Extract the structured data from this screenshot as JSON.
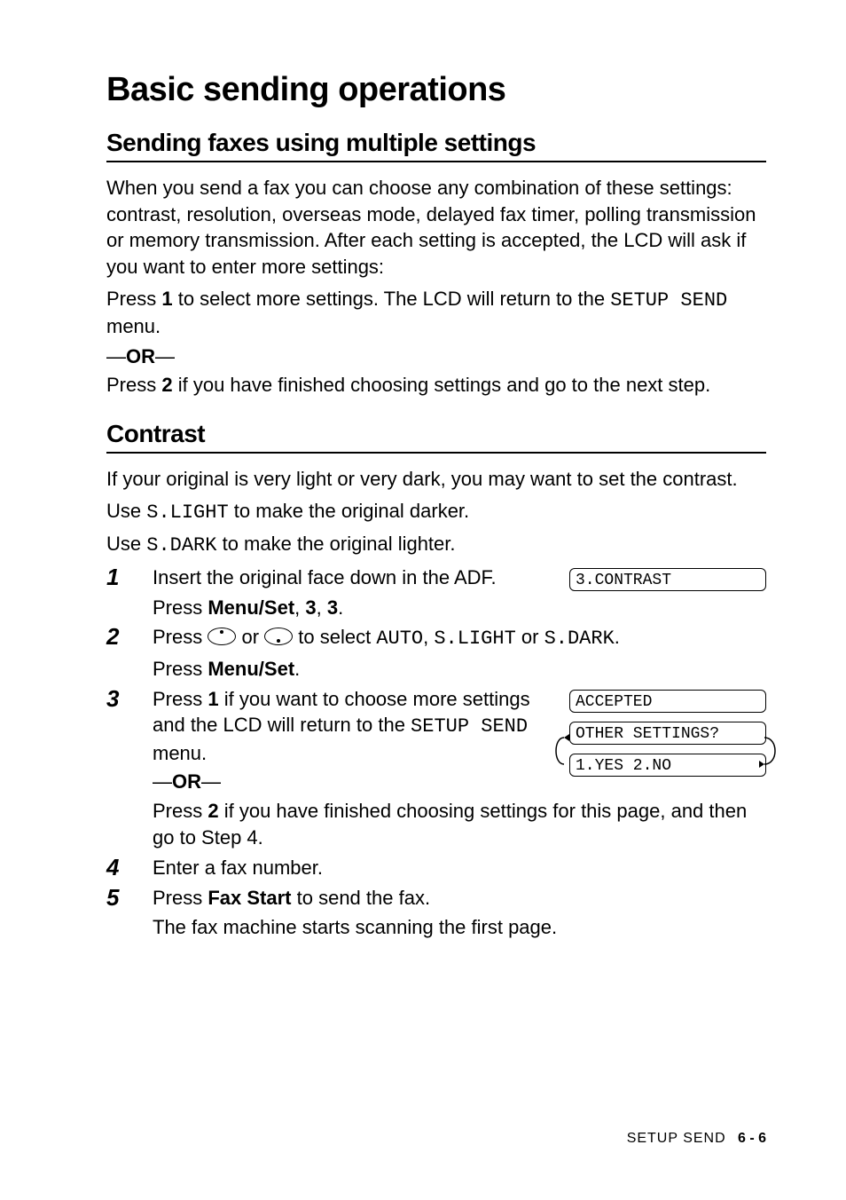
{
  "title": "Basic sending operations",
  "section1": {
    "heading": "Sending faxes using multiple settings",
    "para1_a": "When you send a fax you can choose any combination of these settings: contrast, resolution, overseas mode, delayed fax timer, polling transmission or memory transmission. After each setting is accepted, the LCD will ask if you want to enter more settings:",
    "para2_pre": "Press ",
    "para2_key": "1",
    "para2_mid": " to select more settings. The LCD will return to the ",
    "para2_code": "SETUP SEND",
    "para2_post": " menu.",
    "or_label": "OR",
    "para3_pre": "Press ",
    "para3_key": "2",
    "para3_post": " if you have finished choosing settings and go to the next step."
  },
  "section2": {
    "heading": "Contrast",
    "intro": "If your original is very light or very dark, you may want to set the contrast.",
    "use1_pre": "Use ",
    "use1_code": "S.LIGHT",
    "use1_post": " to make the original darker.",
    "use2_pre": "Use ",
    "use2_code": "S.DARK",
    "use2_post": " to make the original lighter.",
    "steps": {
      "n1": "1",
      "s1a": "Insert the original face down in the ADF.",
      "s1b_pre": "Press ",
      "s1b_key": "Menu/Set",
      "s1b_mid": ", ",
      "s1b_k2": "3",
      "s1b_mid2": ", ",
      "s1b_k3": "3",
      "s1b_post": ".",
      "lcd1": "3.CONTRAST",
      "n2": "2",
      "s2a_pre": "Press ",
      "s2a_mid": " or ",
      "s2a_mid2": " to select ",
      "s2a_c1": "AUTO",
      "s2a_sep1": ", ",
      "s2a_c2": "S.LIGHT",
      "s2a_sep2": " or ",
      "s2a_c3": "S.DARK",
      "s2a_post": ".",
      "s2b_pre": "Press ",
      "s2b_key": "Menu/Set",
      "s2b_post": ".",
      "n3": "3",
      "s3a_pre": "Press ",
      "s3a_key": "1",
      "s3a_mid": " if you want to choose more settings and the LCD will return to the ",
      "s3a_code": "SETUP SEND",
      "s3a_post": " menu.",
      "or_label": "OR",
      "s3b_pre": "Press ",
      "s3b_key": "2",
      "s3b_post": " if you have finished choosing settings for this page, and then go to Step 4.",
      "lcd2a": "ACCEPTED",
      "lcd2b": "OTHER SETTINGS?",
      "lcd2c": "1.YES 2.NO",
      "n4": "4",
      "s4": "Enter a fax number.",
      "n5": "5",
      "s5a_pre": "Press ",
      "s5a_key": "Fax Start",
      "s5a_post": " to send the fax.",
      "s5b": "The fax machine starts scanning the first page."
    }
  },
  "footer": {
    "chapter": "SETUP SEND",
    "page": "6 - 6"
  }
}
